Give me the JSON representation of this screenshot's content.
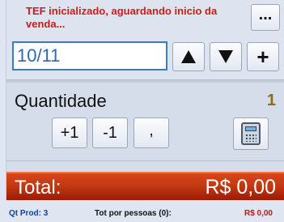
{
  "status": {
    "message": "TEF inicializado, aguardando inicio da venda..."
  },
  "toolbar": {
    "more_label": "...",
    "code_value": "10/11",
    "plus_label": "+"
  },
  "quantity": {
    "label": "Quantidade",
    "value": "1",
    "inc_label": "+1",
    "dec_label": "-1",
    "comma_label": ","
  },
  "total": {
    "label": "Total:",
    "value": "R$ 0,00"
  },
  "footer": {
    "qt_prod": "Qt Prod: 3",
    "tot_pessoas_label": "Tot por pessoas (0):",
    "tot_pessoas_value": "R$ 0,00"
  },
  "colors": {
    "status_text": "#d01a1a",
    "input_border": "#3e7bc6",
    "quantity_value": "#8a6d14",
    "total_bar": "#c33a12"
  },
  "icons": [
    "up-arrow-icon",
    "down-arrow-icon",
    "plus-icon",
    "calculator-icon"
  ]
}
